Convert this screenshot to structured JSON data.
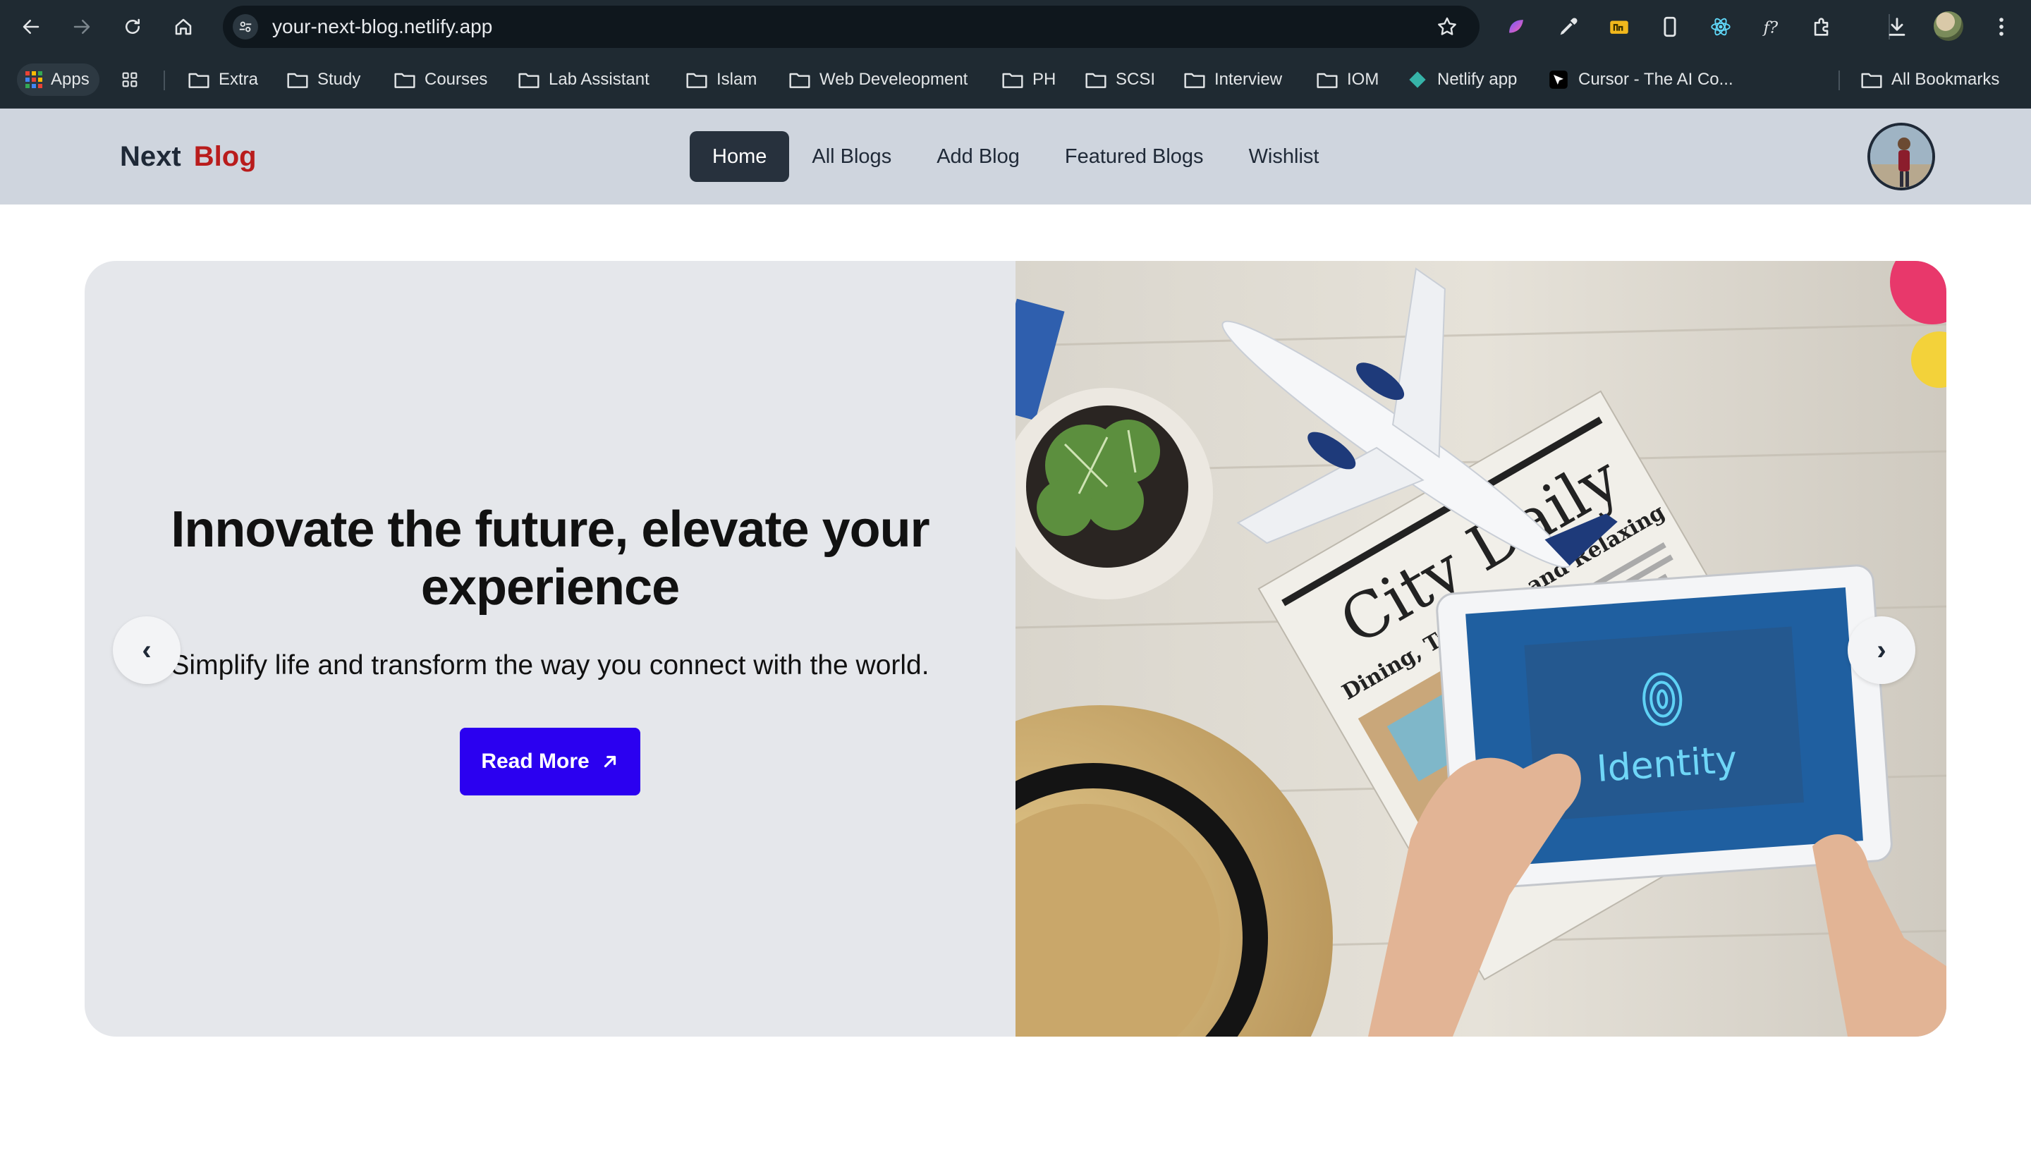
{
  "browser": {
    "url": "your-next-blog.netlify.app",
    "back_icon": "arrow-left-icon",
    "forward_icon": "arrow-right-icon",
    "reload_icon": "reload-icon",
    "home_icon": "home-icon"
  },
  "bookmarks": {
    "apps_label": "Apps",
    "items": [
      {
        "label": "Extra",
        "icon": "folder-icon"
      },
      {
        "label": "Study",
        "icon": "folder-icon"
      },
      {
        "label": "Courses",
        "icon": "folder-icon"
      },
      {
        "label": "Lab Assistant",
        "icon": "folder-icon"
      },
      {
        "label": "Islam",
        "icon": "folder-icon"
      },
      {
        "label": "Web Develeopment",
        "icon": "folder-icon"
      },
      {
        "label": "PH",
        "icon": "folder-icon"
      },
      {
        "label": "SCSI",
        "icon": "folder-icon"
      },
      {
        "label": "Interview",
        "icon": "folder-icon"
      },
      {
        "label": "IOM",
        "icon": "folder-icon"
      }
    ],
    "netlify_label": "Netlify app",
    "cursor_label": "Cursor - The AI Co...",
    "all_bookmarks_label": "All Bookmarks"
  },
  "navbar": {
    "logo_part1": "Next",
    "logo_part2": "Blog",
    "menu": [
      "Home",
      "All Blogs",
      "Add Blog",
      "Featured Blogs",
      "Wishlist"
    ],
    "active_index": 0
  },
  "hero": {
    "title": "Innovate the future, elevate your experience",
    "subtitle": "Simplify life and transform the way you connect with the world.",
    "cta_label": "Read More",
    "prev_label": "‹",
    "next_label": "›",
    "image_newspaper_title": "City Daily",
    "image_newspaper_subtitle": "Dining, Traveling and Relaxing",
    "image_tablet_text": "Identity"
  },
  "colors": {
    "chrome_bg": "#1f2a32",
    "navbar_bg": "#cfd5de",
    "logo_accent": "#b91c1c",
    "active_menu_bg": "#27313d",
    "hero_bg": "#e5e7eb",
    "cta_bg": "#2b00f0"
  }
}
